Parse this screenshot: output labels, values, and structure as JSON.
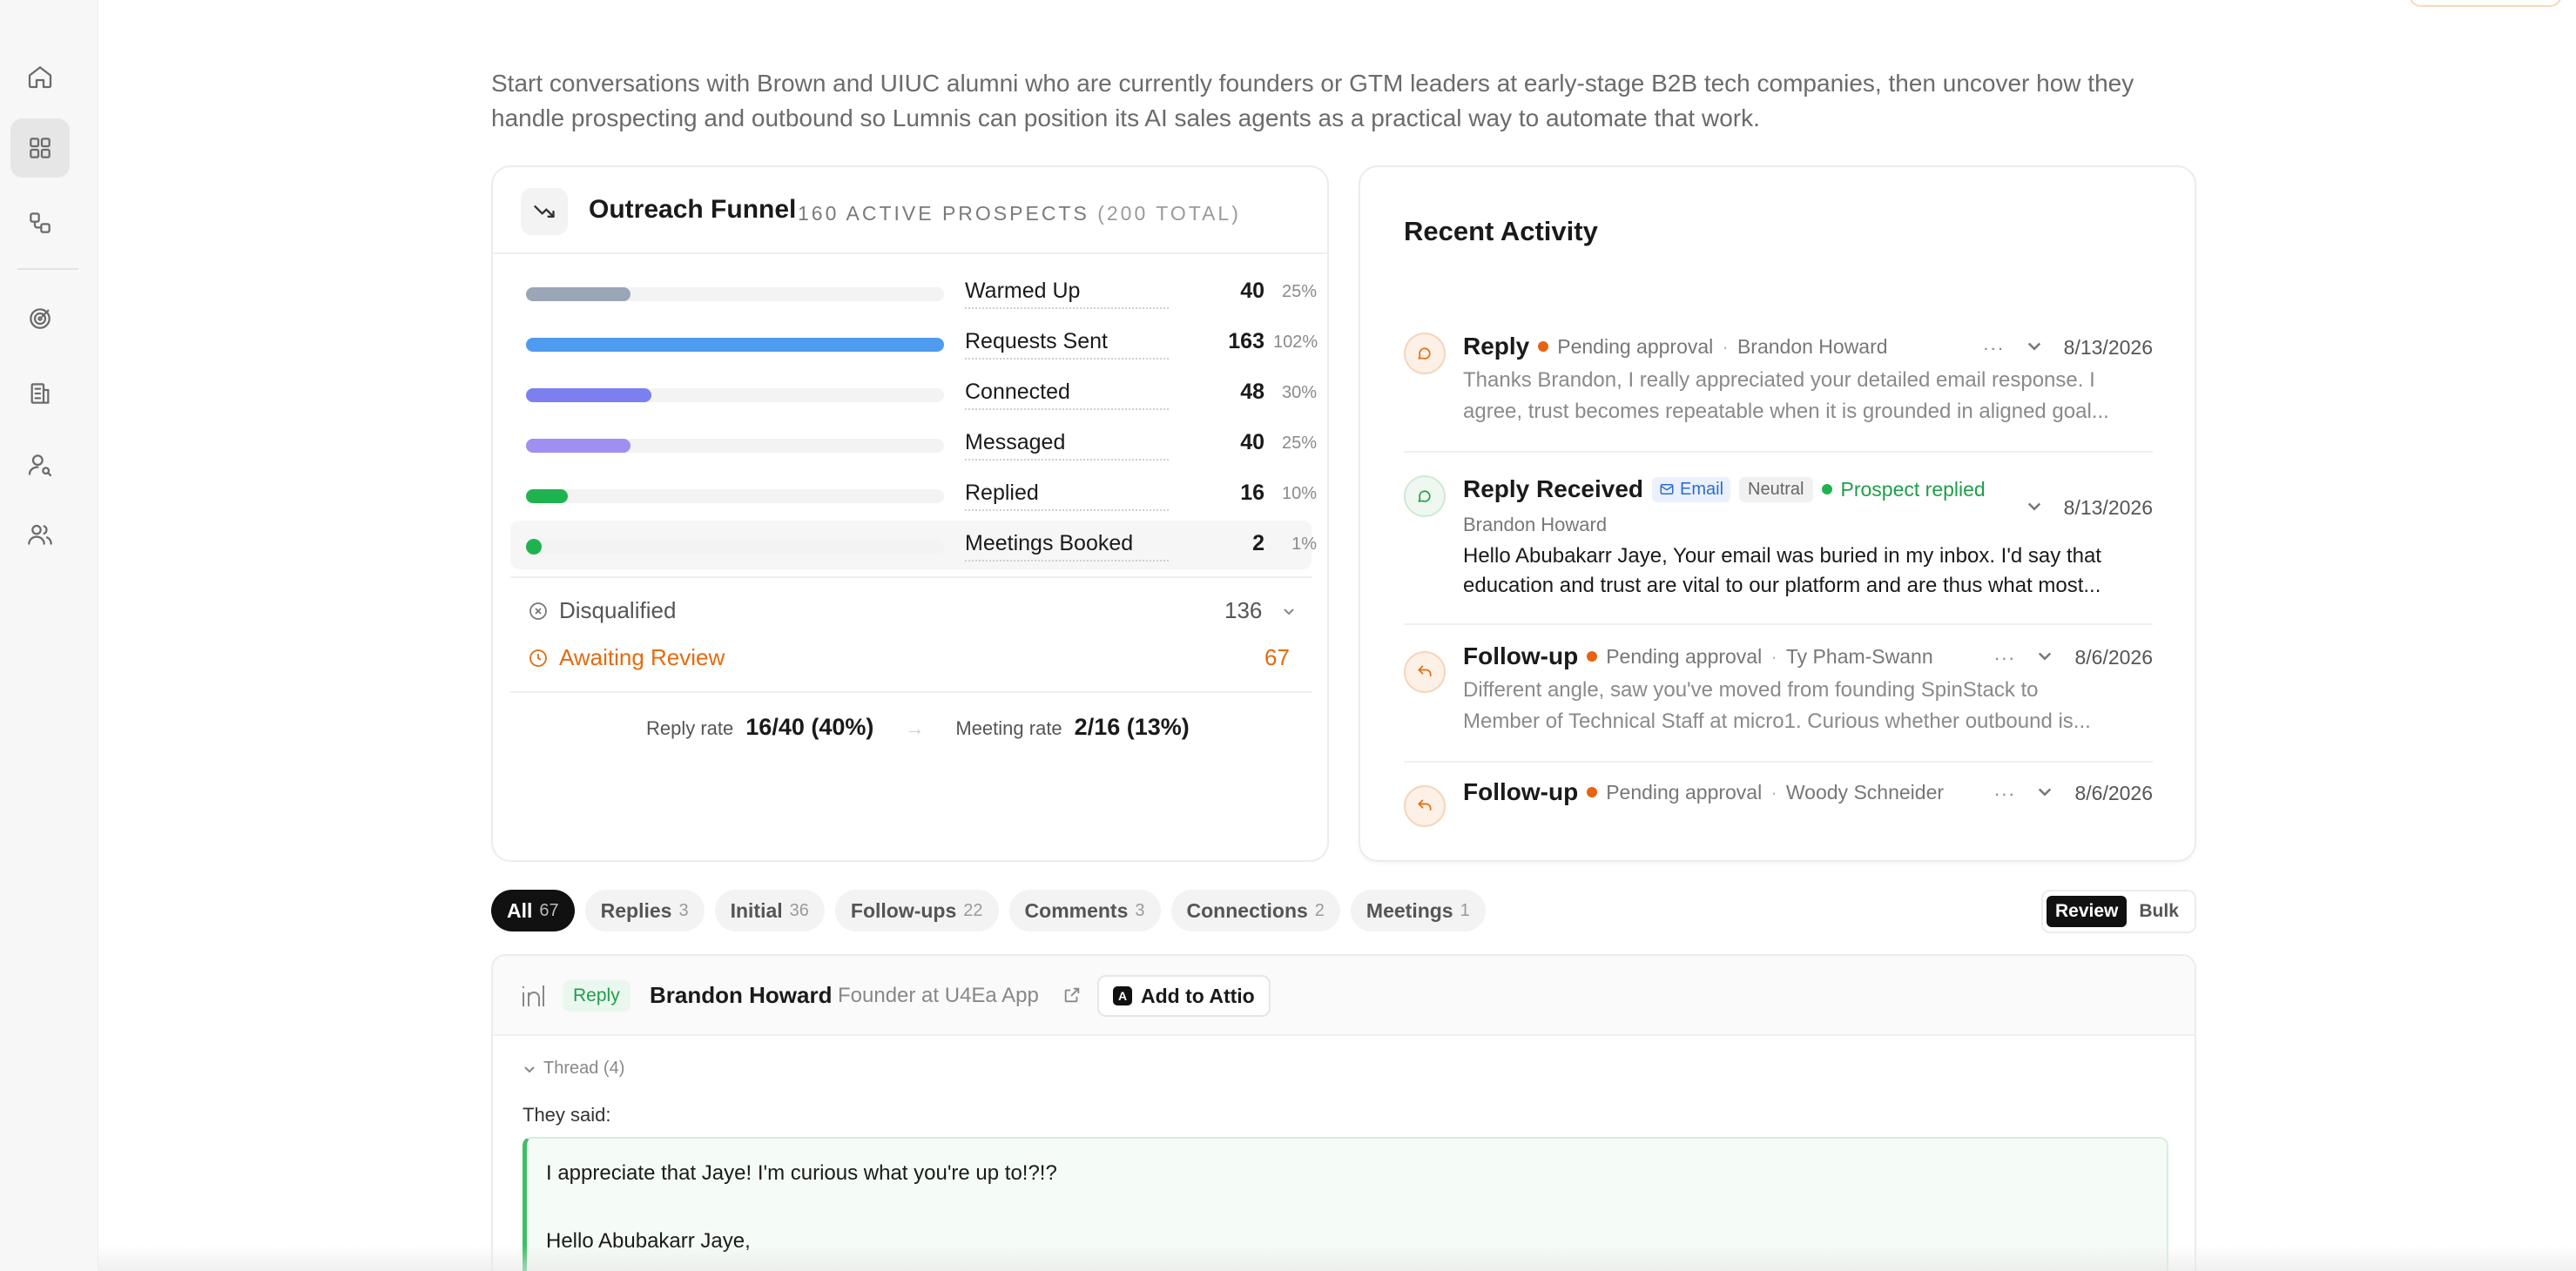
{
  "intro": "Start conversations with Brown and UIUC alumni who are currently founders or GTM leaders at early-stage B2B tech companies, then uncover how they handle prospecting and outbound so Lumnis can position its AI sales agents as a practical way to automate that work.",
  "funnel": {
    "title": "Outreach Funnel",
    "subtitle_main": "160 ACTIVE PROSPECTS",
    "subtitle_total": "(200 TOTAL)",
    "rows": [
      {
        "label": "Warmed Up",
        "count": "40",
        "pct": "25%",
        "fill": 0.25,
        "color": "#9aa6b6"
      },
      {
        "label": "Requests Sent",
        "count": "163",
        "pct": "102%",
        "fill": 1.0,
        "color": "#4e9bf0"
      },
      {
        "label": "Connected",
        "count": "48",
        "pct": "30%",
        "fill": 0.3,
        "color": "#7b7ff0"
      },
      {
        "label": "Messaged",
        "count": "40",
        "pct": "25%",
        "fill": 0.25,
        "color": "#a08ff0"
      },
      {
        "label": "Replied",
        "count": "16",
        "pct": "10%",
        "fill": 0.1,
        "color": "#1fb350"
      },
      {
        "label": "Meetings Booked",
        "count": "2",
        "pct": "1%",
        "fill": 0.02,
        "color": "#1fb350"
      }
    ],
    "disqualified_label": "Disqualified",
    "disqualified_count": "136",
    "awaiting_label": "Awaiting Review",
    "awaiting_count": "67",
    "reply_rate_label": "Reply rate",
    "reply_rate_value": "16/40 (40%)",
    "meeting_rate_label": "Meeting rate",
    "meeting_rate_value": "2/16 (13%)"
  },
  "activity": {
    "title": "Recent Activity",
    "items": [
      {
        "type": "Reply",
        "status": "Pending approval",
        "person": "Brandon Howard",
        "date": "8/13/2026",
        "line1": "Thanks Brandon, I really appreciated your detailed email response. I",
        "line2": "agree, trust becomes repeatable when it is grounded in aligned goal..."
      },
      {
        "type": "Reply Received",
        "channel": "Email",
        "sentiment": "Neutral",
        "status": "Prospect replied",
        "person": "Brandon Howard",
        "date": "8/13/2026",
        "line1": "Hello Abubakarr Jaye, Your email was buried in my inbox. I'd say that",
        "line2": "education and trust are vital to our platform and are thus what most..."
      },
      {
        "type": "Follow-up",
        "status": "Pending approval",
        "person": "Ty Pham-Swann",
        "date": "8/6/2026",
        "line1": "Different angle, saw you've moved from founding SpinStack to",
        "line2": "Member of Technical Staff at micro1. Curious whether outbound is..."
      },
      {
        "type": "Follow-up",
        "status": "Pending approval",
        "person": "Woody Schneider",
        "date": "8/6/2026"
      }
    ]
  },
  "tabs": [
    {
      "label": "All",
      "count": "67"
    },
    {
      "label": "Replies",
      "count": "3"
    },
    {
      "label": "Initial",
      "count": "36"
    },
    {
      "label": "Follow-ups",
      "count": "22"
    },
    {
      "label": "Comments",
      "count": "3"
    },
    {
      "label": "Connections",
      "count": "2"
    },
    {
      "label": "Meetings",
      "count": "1"
    }
  ],
  "view_toggle": {
    "review": "Review",
    "bulk": "Bulk"
  },
  "detail": {
    "tag": "Reply",
    "person": "Brandon Howard",
    "role": "Founder at U4Ea App",
    "attio_button": "Add to Attio",
    "thread_label": "Thread (4)",
    "they_said": "They said:",
    "message_line1": "I appreciate that Jaye! I'm curious what you're up to!?!?",
    "message_line2": "Hello Abubakarr Jaye,"
  }
}
